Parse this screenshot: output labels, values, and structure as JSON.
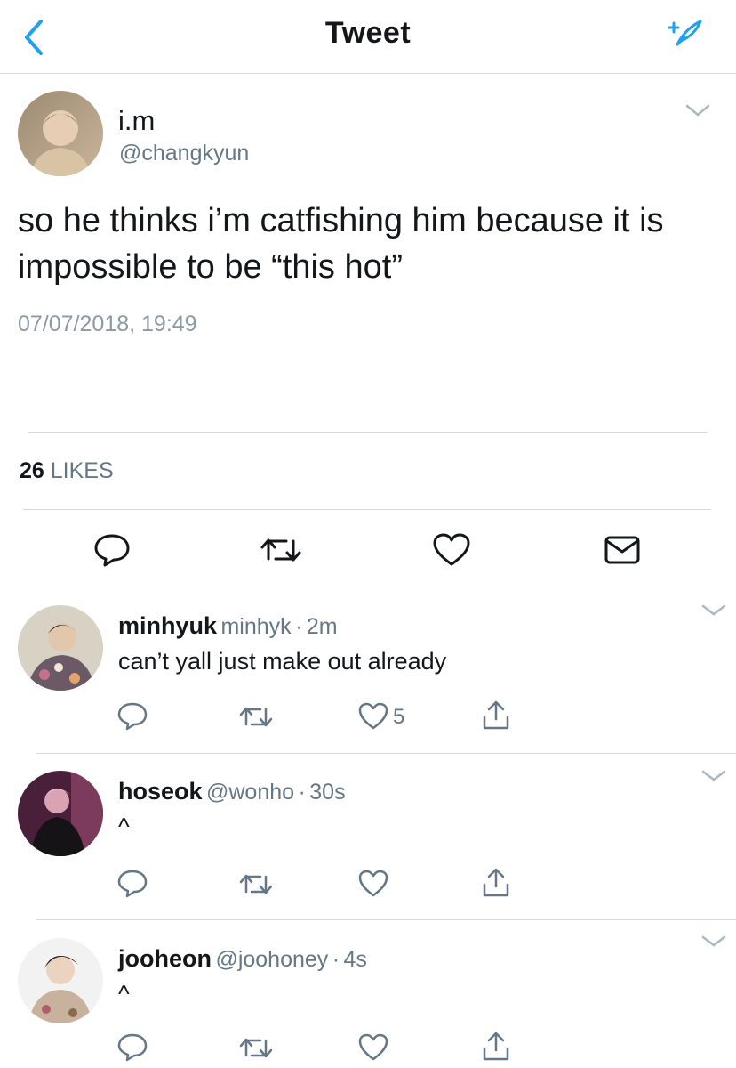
{
  "header": {
    "title": "Tweet",
    "back_icon": "chevron-left-icon",
    "compose_icon": "compose-tweet-icon"
  },
  "tweet": {
    "name": "i.m",
    "handle": "@changkyun",
    "text": "so he thinks i’m catfishing him because it is impossible to be “this hot”",
    "timestamp": "07/07/2018, 19:49",
    "likes_count": "26",
    "likes_label": "LIKES",
    "actions": [
      "reply-icon",
      "retweet-icon",
      "like-icon",
      "message-icon"
    ]
  },
  "replies": [
    {
      "name": "minhyuk",
      "handle": "minhyk",
      "dot": "·",
      "time": "2m",
      "text": "can’t yall just make out already",
      "like_count": "5"
    },
    {
      "name": "hoseok",
      "handle": "@wonho",
      "dot": "·",
      "time": "30s",
      "text": "^",
      "like_count": ""
    },
    {
      "name": "jooheon",
      "handle": "@joohoney",
      "dot": "·",
      "time": "4s",
      "text": "^",
      "like_count": ""
    }
  ],
  "colors": {
    "accent": "#1da1f2",
    "icon_gray": "#657786",
    "divider": "#d9d9d9",
    "text": "#14171a"
  }
}
